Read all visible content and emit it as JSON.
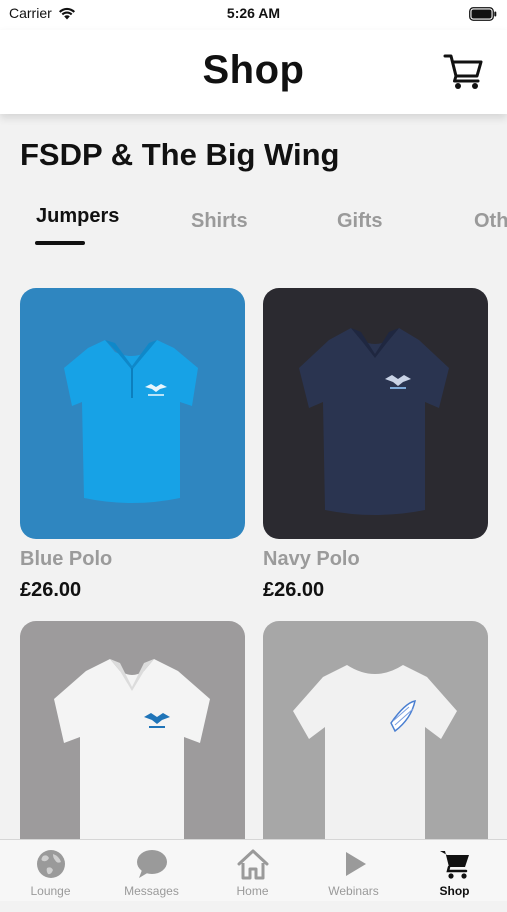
{
  "status_bar": {
    "carrier": "Carrier",
    "time": "5:26 AM"
  },
  "header": {
    "title": "Shop",
    "cart_icon": "cart-icon"
  },
  "section": {
    "title": "FSDP & The Big Wing"
  },
  "categories": [
    {
      "label": "Jumpers",
      "active": true
    },
    {
      "label": "Shirts",
      "active": false
    },
    {
      "label": "Gifts",
      "active": false
    },
    {
      "label": "Oth",
      "active": false
    }
  ],
  "products": [
    {
      "name": "Blue Polo",
      "price": "£26.00",
      "background": "#2f86c0",
      "garment_color": "#17a2e6"
    },
    {
      "name": "Navy Polo",
      "price": "£26.00",
      "background": "#2b2a30",
      "garment_color": "#2a3450"
    },
    {
      "name": "",
      "price": "",
      "background": "#9d9b9c",
      "garment_color": "#f4f4f4"
    },
    {
      "name": "",
      "price": "",
      "background": "#a7a7a7",
      "garment_color": "#f1f1f1"
    }
  ],
  "tab_bar": {
    "items": [
      {
        "label": "Lounge",
        "icon": "globe-icon",
        "active": false
      },
      {
        "label": "Messages",
        "icon": "chat-bubble-icon",
        "active": false
      },
      {
        "label": "Home",
        "icon": "home-icon",
        "active": false
      },
      {
        "label": "Webinars",
        "icon": "play-icon",
        "active": false
      },
      {
        "label": "Shop",
        "icon": "cart-icon",
        "active": true
      }
    ]
  },
  "colors": {
    "accent": "#111111",
    "inactive": "#9a9a9a",
    "header_bg": "#ffffff",
    "page_bg": "#f2f2f2"
  }
}
